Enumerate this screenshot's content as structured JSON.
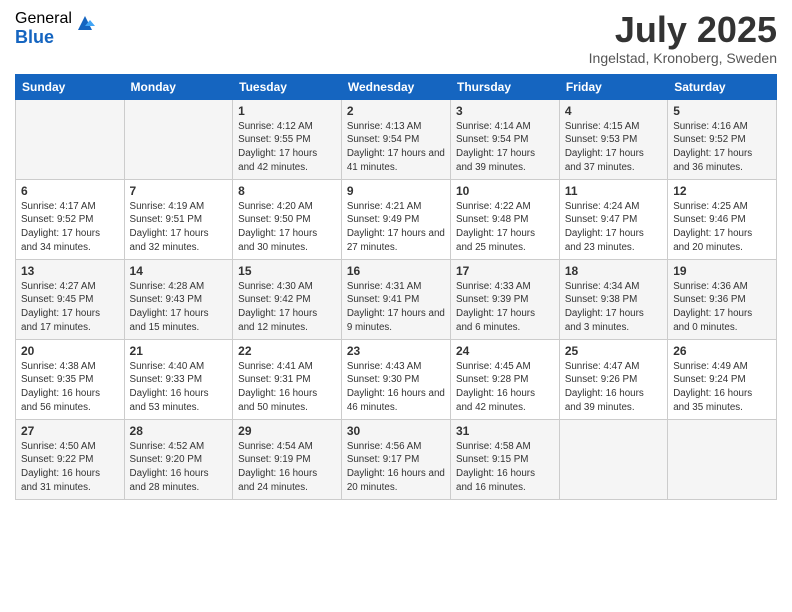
{
  "logo": {
    "general": "General",
    "blue": "Blue"
  },
  "title": "July 2025",
  "location": "Ingelstad, Kronoberg, Sweden",
  "days_of_week": [
    "Sunday",
    "Monday",
    "Tuesday",
    "Wednesday",
    "Thursday",
    "Friday",
    "Saturday"
  ],
  "weeks": [
    [
      {
        "day": "",
        "sunrise": "",
        "sunset": "",
        "daylight": ""
      },
      {
        "day": "",
        "sunrise": "",
        "sunset": "",
        "daylight": ""
      },
      {
        "day": "1",
        "sunrise": "Sunrise: 4:12 AM",
        "sunset": "Sunset: 9:55 PM",
        "daylight": "Daylight: 17 hours and 42 minutes."
      },
      {
        "day": "2",
        "sunrise": "Sunrise: 4:13 AM",
        "sunset": "Sunset: 9:54 PM",
        "daylight": "Daylight: 17 hours and 41 minutes."
      },
      {
        "day": "3",
        "sunrise": "Sunrise: 4:14 AM",
        "sunset": "Sunset: 9:54 PM",
        "daylight": "Daylight: 17 hours and 39 minutes."
      },
      {
        "day": "4",
        "sunrise": "Sunrise: 4:15 AM",
        "sunset": "Sunset: 9:53 PM",
        "daylight": "Daylight: 17 hours and 37 minutes."
      },
      {
        "day": "5",
        "sunrise": "Sunrise: 4:16 AM",
        "sunset": "Sunset: 9:52 PM",
        "daylight": "Daylight: 17 hours and 36 minutes."
      }
    ],
    [
      {
        "day": "6",
        "sunrise": "Sunrise: 4:17 AM",
        "sunset": "Sunset: 9:52 PM",
        "daylight": "Daylight: 17 hours and 34 minutes."
      },
      {
        "day": "7",
        "sunrise": "Sunrise: 4:19 AM",
        "sunset": "Sunset: 9:51 PM",
        "daylight": "Daylight: 17 hours and 32 minutes."
      },
      {
        "day": "8",
        "sunrise": "Sunrise: 4:20 AM",
        "sunset": "Sunset: 9:50 PM",
        "daylight": "Daylight: 17 hours and 30 minutes."
      },
      {
        "day": "9",
        "sunrise": "Sunrise: 4:21 AM",
        "sunset": "Sunset: 9:49 PM",
        "daylight": "Daylight: 17 hours and 27 minutes."
      },
      {
        "day": "10",
        "sunrise": "Sunrise: 4:22 AM",
        "sunset": "Sunset: 9:48 PM",
        "daylight": "Daylight: 17 hours and 25 minutes."
      },
      {
        "day": "11",
        "sunrise": "Sunrise: 4:24 AM",
        "sunset": "Sunset: 9:47 PM",
        "daylight": "Daylight: 17 hours and 23 minutes."
      },
      {
        "day": "12",
        "sunrise": "Sunrise: 4:25 AM",
        "sunset": "Sunset: 9:46 PM",
        "daylight": "Daylight: 17 hours and 20 minutes."
      }
    ],
    [
      {
        "day": "13",
        "sunrise": "Sunrise: 4:27 AM",
        "sunset": "Sunset: 9:45 PM",
        "daylight": "Daylight: 17 hours and 17 minutes."
      },
      {
        "day": "14",
        "sunrise": "Sunrise: 4:28 AM",
        "sunset": "Sunset: 9:43 PM",
        "daylight": "Daylight: 17 hours and 15 minutes."
      },
      {
        "day": "15",
        "sunrise": "Sunrise: 4:30 AM",
        "sunset": "Sunset: 9:42 PM",
        "daylight": "Daylight: 17 hours and 12 minutes."
      },
      {
        "day": "16",
        "sunrise": "Sunrise: 4:31 AM",
        "sunset": "Sunset: 9:41 PM",
        "daylight": "Daylight: 17 hours and 9 minutes."
      },
      {
        "day": "17",
        "sunrise": "Sunrise: 4:33 AM",
        "sunset": "Sunset: 9:39 PM",
        "daylight": "Daylight: 17 hours and 6 minutes."
      },
      {
        "day": "18",
        "sunrise": "Sunrise: 4:34 AM",
        "sunset": "Sunset: 9:38 PM",
        "daylight": "Daylight: 17 hours and 3 minutes."
      },
      {
        "day": "19",
        "sunrise": "Sunrise: 4:36 AM",
        "sunset": "Sunset: 9:36 PM",
        "daylight": "Daylight: 17 hours and 0 minutes."
      }
    ],
    [
      {
        "day": "20",
        "sunrise": "Sunrise: 4:38 AM",
        "sunset": "Sunset: 9:35 PM",
        "daylight": "Daylight: 16 hours and 56 minutes."
      },
      {
        "day": "21",
        "sunrise": "Sunrise: 4:40 AM",
        "sunset": "Sunset: 9:33 PM",
        "daylight": "Daylight: 16 hours and 53 minutes."
      },
      {
        "day": "22",
        "sunrise": "Sunrise: 4:41 AM",
        "sunset": "Sunset: 9:31 PM",
        "daylight": "Daylight: 16 hours and 50 minutes."
      },
      {
        "day": "23",
        "sunrise": "Sunrise: 4:43 AM",
        "sunset": "Sunset: 9:30 PM",
        "daylight": "Daylight: 16 hours and 46 minutes."
      },
      {
        "day": "24",
        "sunrise": "Sunrise: 4:45 AM",
        "sunset": "Sunset: 9:28 PM",
        "daylight": "Daylight: 16 hours and 42 minutes."
      },
      {
        "day": "25",
        "sunrise": "Sunrise: 4:47 AM",
        "sunset": "Sunset: 9:26 PM",
        "daylight": "Daylight: 16 hours and 39 minutes."
      },
      {
        "day": "26",
        "sunrise": "Sunrise: 4:49 AM",
        "sunset": "Sunset: 9:24 PM",
        "daylight": "Daylight: 16 hours and 35 minutes."
      }
    ],
    [
      {
        "day": "27",
        "sunrise": "Sunrise: 4:50 AM",
        "sunset": "Sunset: 9:22 PM",
        "daylight": "Daylight: 16 hours and 31 minutes."
      },
      {
        "day": "28",
        "sunrise": "Sunrise: 4:52 AM",
        "sunset": "Sunset: 9:20 PM",
        "daylight": "Daylight: 16 hours and 28 minutes."
      },
      {
        "day": "29",
        "sunrise": "Sunrise: 4:54 AM",
        "sunset": "Sunset: 9:19 PM",
        "daylight": "Daylight: 16 hours and 24 minutes."
      },
      {
        "day": "30",
        "sunrise": "Sunrise: 4:56 AM",
        "sunset": "Sunset: 9:17 PM",
        "daylight": "Daylight: 16 hours and 20 minutes."
      },
      {
        "day": "31",
        "sunrise": "Sunrise: 4:58 AM",
        "sunset": "Sunset: 9:15 PM",
        "daylight": "Daylight: 16 hours and 16 minutes."
      },
      {
        "day": "",
        "sunrise": "",
        "sunset": "",
        "daylight": ""
      },
      {
        "day": "",
        "sunrise": "",
        "sunset": "",
        "daylight": ""
      }
    ]
  ]
}
